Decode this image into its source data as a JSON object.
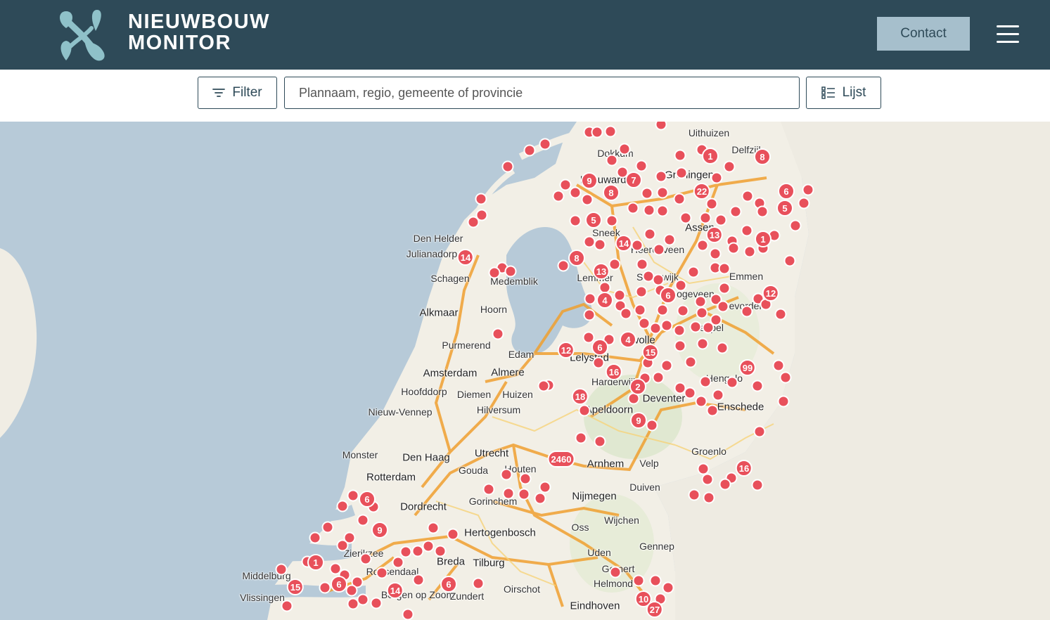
{
  "header": {
    "brand_line1": "NIEUWBOUW",
    "brand_line2": "MONITOR",
    "contact_label": "Contact",
    "menu_icon": "hamburger-icon"
  },
  "toolbar": {
    "filter_label": "Filter",
    "search_placeholder": "Plannaam, regio, gemeente of provincie",
    "list_label": "Lijst"
  },
  "colors": {
    "header_bg": "#2e4a58",
    "contact_bg": "#a6bfcc",
    "marker": "#e8505b",
    "water": "#b7cad8",
    "land": "#f2efe6"
  },
  "map": {
    "cities": [
      "Uithuizen",
      "Delfzijl",
      "Dokkum",
      "Groningen",
      "Leeuwarden",
      "Assen",
      "Sneek",
      "Heerenveen",
      "Den Helder",
      "Julianadorp",
      "Schagen",
      "Medemblik",
      "Alkmaar",
      "Hoorn",
      "Emmen",
      "Lemmer",
      "Steenwijk",
      "Hoogeveen",
      "Coevorden",
      "Purmerend",
      "Edam",
      "Lelystad",
      "Zwolle",
      "Meppel",
      "Amsterdam",
      "Almere",
      "Hoofddorp",
      "Diemen",
      "Huizen",
      "Harderwijk",
      "Deventer",
      "Hengelo",
      "Enschede",
      "Nieuw-Vennep",
      "Hilversum",
      "Apeldoorn",
      "Monster",
      "Den Haag",
      "Utrecht",
      "Groenlo",
      "Rotterdam",
      "Gouda",
      "Houten",
      "Arnhem",
      "Velp",
      "Duiven",
      "Dordrecht",
      "Gorinchem",
      "Nijmegen",
      "Wijchen",
      "Hertogenbosch",
      "Oss",
      "Gennep",
      "Zierikzee",
      "Breda",
      "Tilburg",
      "Uden",
      "Middelburg",
      "Roosendaal",
      "Gemert",
      "Oirschot",
      "Helmond",
      "Vlissingen",
      "Bergen op Zoom",
      "Zundert",
      "Eindhoven"
    ],
    "clusters": [
      "1",
      "8",
      "9",
      "7",
      "8",
      "22",
      "6",
      "5",
      "5",
      "13",
      "1",
      "14",
      "14",
      "8",
      "13",
      "4",
      "6",
      "12",
      "12",
      "6",
      "4",
      "15",
      "16",
      "99",
      "18",
      "2",
      "9",
      "2460",
      "16",
      "6",
      "9",
      "1",
      "15",
      "6",
      "14",
      "6",
      "10",
      "27"
    ]
  }
}
